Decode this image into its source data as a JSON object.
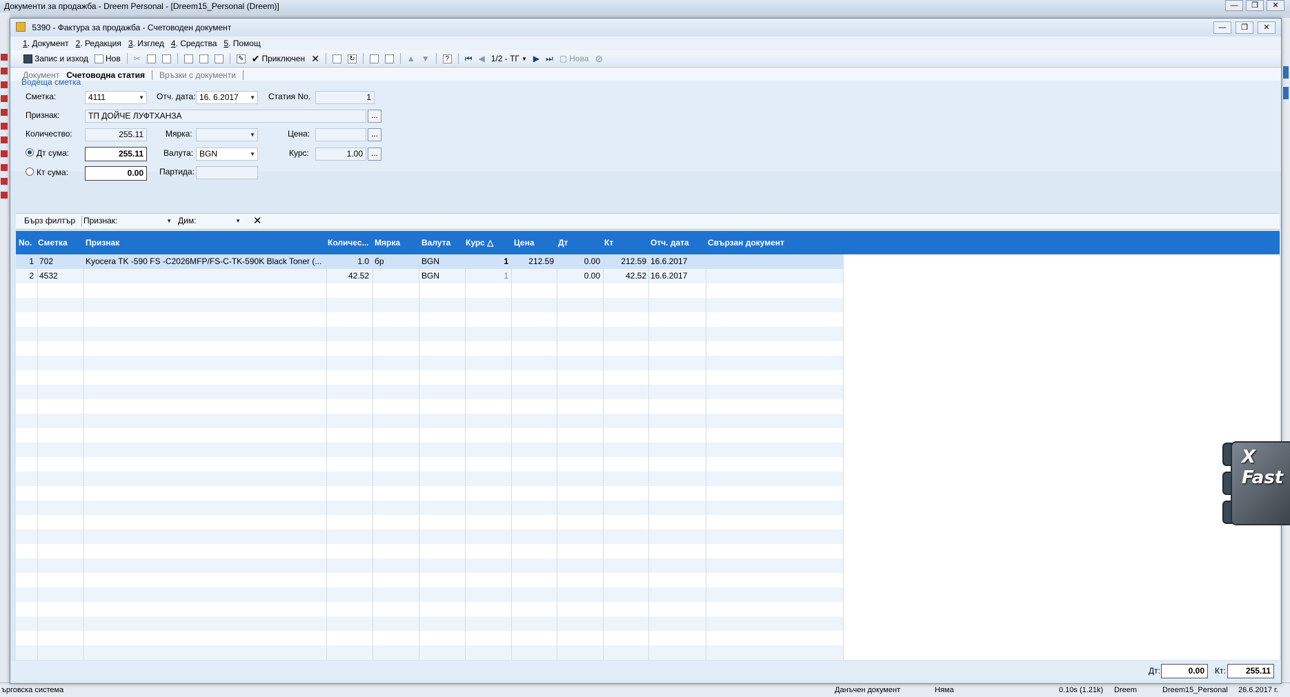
{
  "background": {
    "title": "Документи за продажба - Dreem Personal - [Dreem15_Personal (Dreem)]",
    "status_left": "ърговска система",
    "status_mid1": "Данъчен документ",
    "status_mid2": "Няма",
    "status_size": "0.10s (1.21k)",
    "status_user": "Dreem",
    "status_db": "Dreem15_Personal",
    "status_date": "26.6.2017 г."
  },
  "window": {
    "title": "5390 - Фактура за продажба - Счетоводен документ"
  },
  "menu": [
    {
      "key": "1",
      "label": ". Документ"
    },
    {
      "key": "2",
      "label": ". Редакция"
    },
    {
      "key": "3",
      "label": ". Изглед"
    },
    {
      "key": "4",
      "label": ". Средства"
    },
    {
      "key": "5",
      "label": ". Помощ"
    }
  ],
  "toolbar": {
    "save_exit": "Запис и изход",
    "new": "Нов",
    "closed": "Приключен",
    "page_indicator": "1/2 - ТГ",
    "new_disabled": "Нова"
  },
  "tabs": [
    {
      "label": "Документ",
      "active": false
    },
    {
      "label": "Счетоводна статия",
      "active": true
    },
    {
      "label": "Връзки с документи",
      "active": false
    }
  ],
  "form": {
    "section_link": "Водеща сметка",
    "account_label": "Сметка:",
    "account_value": "4111",
    "report_date_label": "Отч. дата:",
    "report_date_value": "16. 6.2017",
    "entry_no_label": "Статия No.",
    "entry_no_value": "1",
    "sign_label": "Признак:",
    "sign_value": "ТП ДОЙЧЕ ЛУФТХАНЗА",
    "qty_label": "Количество:",
    "qty_value": "255.11",
    "unit_label": "Мярка:",
    "unit_value": "",
    "price_label": "Цена:",
    "price_value": "",
    "dt_label": "Дт сума:",
    "dt_value": "255.11",
    "currency_label": "Валута:",
    "currency_value": "BGN",
    "rate_label": "Курс:",
    "rate_value": "1.00",
    "kt_label": "Кт сума:",
    "kt_value": "0.00",
    "batch_label": "Партида:",
    "batch_value": "",
    "dots": "..."
  },
  "filter": {
    "quick": "Бърз филтър",
    "sign_label": "Признак:",
    "dim_label": "Дим:"
  },
  "grid": {
    "columns": [
      "No.",
      "Сметка",
      "Признак",
      "Количес...",
      "Мярка",
      "Валута",
      "Курс △",
      "Цена",
      "Дт",
      "Кт",
      "Отч. дата",
      "Свързан документ"
    ],
    "rows": [
      {
        "no": "1",
        "account": "702",
        "sign": "Kyocera TK -590 FS -C2026MFP/FS-C-TK-590K Black Toner (...",
        "qty": "1.0",
        "unit": "бр",
        "currency": "BGN",
        "rate": "1",
        "price": "212.59",
        "dt": "0.00",
        "kt": "212.59",
        "date": "16.6.2017",
        "linked": ""
      },
      {
        "no": "2",
        "account": "4532",
        "sign": "",
        "qty": "42.52",
        "unit": "",
        "currency": "BGN",
        "rate": "1",
        "price": "",
        "dt": "0.00",
        "kt": "42.52",
        "date": "16.6.2017",
        "linked": ""
      }
    ]
  },
  "footer": {
    "dt_label": "Дт:",
    "dt_value": "0.00",
    "kt_label": "Кт:",
    "kt_value": "255.11"
  },
  "overlay": {
    "brand": "X Fast"
  },
  "icons": [
    "save-icon",
    "new-doc-icon",
    "cut-icon",
    "copy-icon",
    "paste-icon",
    "print-icon",
    "preview-icon",
    "check-icon",
    "close-icon",
    "first-icon",
    "prev-icon",
    "next-icon",
    "last-icon",
    "help-icon"
  ]
}
